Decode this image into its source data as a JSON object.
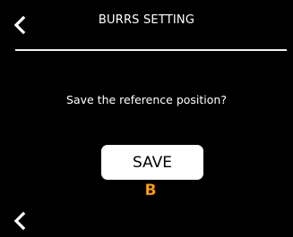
{
  "header": {
    "title": "BURRS SETTING",
    "back_icon": "chevron-left-icon"
  },
  "dialog": {
    "prompt": "Save the reference position?",
    "save_label": "SAVE",
    "badge_letter": "B",
    "badge_color": "#f5a623"
  },
  "footer": {
    "back_icon": "chevron-left-icon"
  },
  "colors": {
    "background": "#000000",
    "foreground": "#ffffff"
  }
}
